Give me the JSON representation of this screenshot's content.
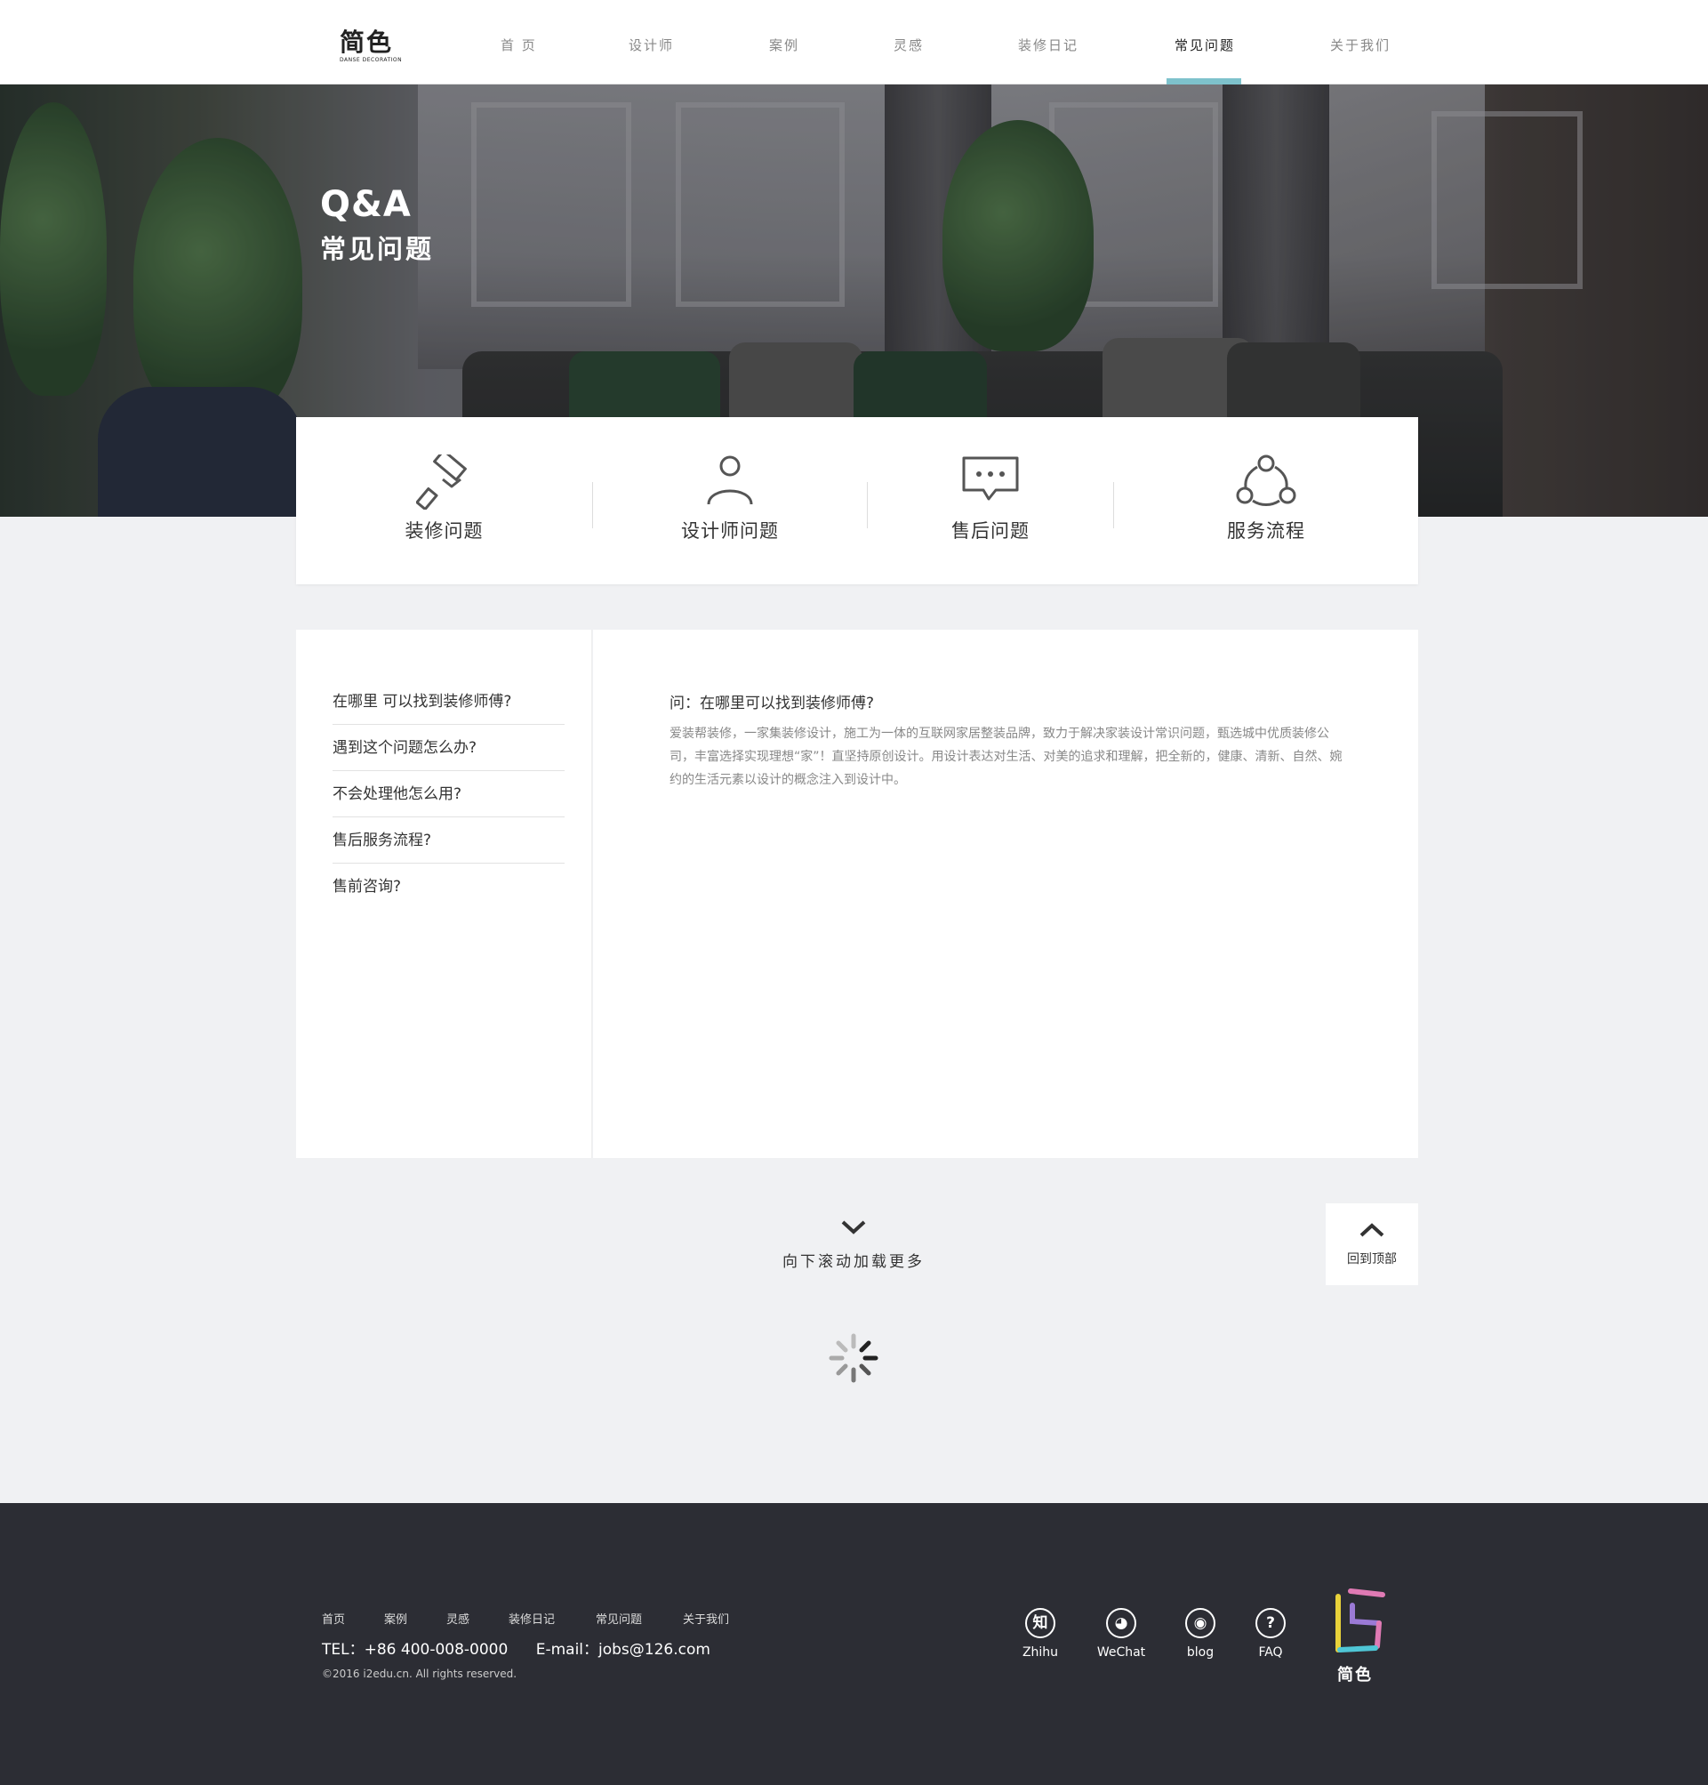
{
  "brand": {
    "logo_text": "简色",
    "logo_sub": "DANSE DECORATION"
  },
  "nav": [
    {
      "label": "首 页"
    },
    {
      "label": "设计师"
    },
    {
      "label": "案例"
    },
    {
      "label": "灵感"
    },
    {
      "label": "装修日记"
    },
    {
      "label": "常见问题",
      "active": true
    },
    {
      "label": "关于我们"
    }
  ],
  "hero": {
    "title": "Q&A",
    "subtitle": "常见问题"
  },
  "categories": [
    {
      "label": "装修问题",
      "icon": "paint-roller-icon"
    },
    {
      "label": "设计师问题",
      "icon": "person-icon"
    },
    {
      "label": "售后问题",
      "icon": "chat-bubble-icon"
    },
    {
      "label": "服务流程",
      "icon": "process-cycle-icon"
    }
  ],
  "questions": [
    "在哪里 可以找到装修师傅?",
    "遇到这个问题怎么办?",
    "不会处理他怎么用?",
    "售后服务流程?",
    "售前咨询?"
  ],
  "answer": {
    "title": "问：在哪里可以找到装修师傅?",
    "body": "爱装帮装修，一家集装修设计，施工为一体的互联网家居整装品牌，致力于解决家装设计常识问题，甄选城中优质装修公司，丰富选择实现理想“家”！直坚持原创设计。用设计表达对生活、对美的追求和理解，把全新的，健康、清新、自然、婉约的生活元素以设计的概念注入到设计中。"
  },
  "load_more": {
    "label": "向下滚动加载更多"
  },
  "back_to_top": {
    "label": "回到顶部"
  },
  "footer": {
    "links": [
      "首页",
      "案例",
      "灵感",
      "装修日记",
      "常见问题",
      "关于我们"
    ],
    "tel": "TEL：+86 400-008-0000",
    "email": "E-mail：jobs@126.com",
    "copyright": "©2016 i2edu.cn. All rights reserved.",
    "social": [
      {
        "label": "Zhihu",
        "glyph": "知",
        "icon": "zhihu-icon"
      },
      {
        "label": "WeChat",
        "glyph": "◕",
        "icon": "wechat-icon"
      },
      {
        "label": "blog",
        "glyph": "◉",
        "icon": "weibo-icon"
      },
      {
        "label": "FAQ",
        "glyph": "?",
        "icon": "faq-icon"
      }
    ],
    "logo_text": "简色"
  },
  "colors": {
    "accent": "#7ec2cc",
    "footer_bg": "#2c2d34",
    "page_bg": "#f0f1f3"
  }
}
